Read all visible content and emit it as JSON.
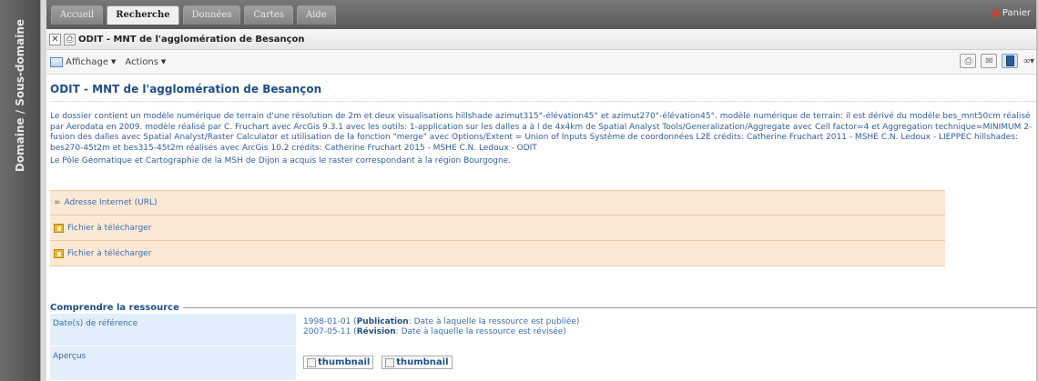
{
  "sidebar": {
    "label": "Domaine / Sous-domaine"
  },
  "nav": {
    "tabs": [
      {
        "label": "Accueil"
      },
      {
        "label": "Recherche"
      },
      {
        "label": "Données"
      },
      {
        "label": "Cartes"
      },
      {
        "label": "Aide"
      }
    ],
    "active_tab": "Recherche",
    "cart_label": "Panier"
  },
  "window": {
    "title": "ODIT - MNT de l'agglomération de Besançon"
  },
  "toolbar": {
    "display_label": "Affichage",
    "actions_label": "Actions"
  },
  "resource": {
    "title": "ODIT - MNT de l'agglomération de Besançon",
    "description": "Le dossier contient un modèle numérique de terrain d'une résolution de 2m et deux visualisations hillshade azimut315°-élévation45° et azimut270°-élévation45°. modèle numérique de terrain: il est dérivé du modèle bes_mnt50cm réalisé par Aerodata en 2009. modèle réalisé par C. Fruchart avec ArcGis 9.3.1 avec les outils: 1-application sur les dalles a à l de 4x4km de Spatial Analyst Tools/Generalization/Aggregate avec Cell factor=4 et Aggregation technique=MINIMUM 2-fusion des dalles avec Spatial Analyst/Raster Calculator et utilisation de la fonction \"merge\" avec Options/Extent = Union of Inputs Système de coordonnées L2E crédits: Catherine Fruchart 2011 - MSHE C.N. Ledoux - LIEPPEC hillshades: bes270-45t2m et bes315-45t2m réalisés avec ArcGis 10.2 crédits: Catherine Fruchart 2015 - MSHE C.N. Ledoux - ODIT",
    "description_extra": "Le Pôle Géomatique et Cartographie de la MSH de Dijon a acquis le raster correspondant à la région Bourgogne."
  },
  "links": [
    {
      "label": "Adresse Internet (URL)",
      "icon": "url-link-icon"
    },
    {
      "label": "Fichier à télécharger",
      "icon": "file-download-icon"
    },
    {
      "label": "Fichier à télécharger",
      "icon": "file-download-icon"
    }
  ],
  "section": {
    "title": "Comprendre la ressource",
    "rows": [
      {
        "key": "Date(s) de référence",
        "values": [
          {
            "date": "1998-01-01",
            "type": "Publication",
            "desc": ": Date à laquelle la ressource est publiée)"
          },
          {
            "date": "2007-05-11",
            "type": "Révision",
            "desc": ": Date à laquelle la ressource est révisée)"
          }
        ]
      },
      {
        "key": "Aperçus",
        "thumbs": [
          "thumbnail",
          "thumbnail"
        ]
      }
    ]
  }
}
